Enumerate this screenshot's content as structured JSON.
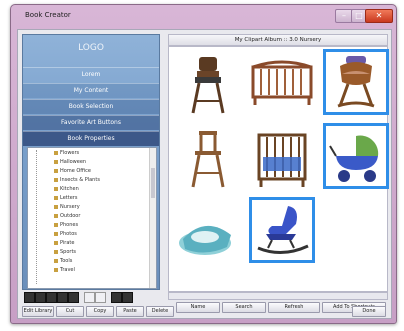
{
  "window": {
    "title": "Book Creator"
  },
  "sidebar": {
    "logo_text": "LOGO",
    "nav": [
      "Lorem",
      "My Content",
      "Book Selection",
      "Favorite Art Buttons",
      "Book Properties"
    ]
  },
  "tree": {
    "items": [
      "Flowers",
      "Halloween",
      "Home Office",
      "Insects & Plants",
      "Kitchen",
      "Letters",
      "Nursery",
      "Outdoor",
      "Phones",
      "Photos",
      "Pirate",
      "Sports",
      "Tools",
      "Travel"
    ]
  },
  "breadcrumb": "My Clipart Album :: 3.0 Nursery",
  "clipart": [
    {
      "name": "high-chair",
      "selected": false
    },
    {
      "name": "crib",
      "selected": false
    },
    {
      "name": "bassinet",
      "selected": true
    },
    {
      "name": "wooden-high-chair",
      "selected": false
    },
    {
      "name": "crib-with-blanket",
      "selected": false
    },
    {
      "name": "baby-carriage",
      "selected": true
    },
    {
      "name": "baby-bathtub",
      "selected": false
    },
    {
      "name": "rocking-chair",
      "selected": true
    }
  ],
  "panel_buttons": [
    "Name",
    "Search",
    "Refresh",
    "Add To Shortcuts"
  ],
  "bottom_buttons": [
    "Edit Library",
    "Cut",
    "Copy",
    "Paste",
    "Delete",
    "Find",
    "Properties",
    "Done"
  ],
  "colors": {
    "selection": "#2f8ee8",
    "sidebar": "#7aa0cc",
    "title_bar": "#c79fc5"
  }
}
